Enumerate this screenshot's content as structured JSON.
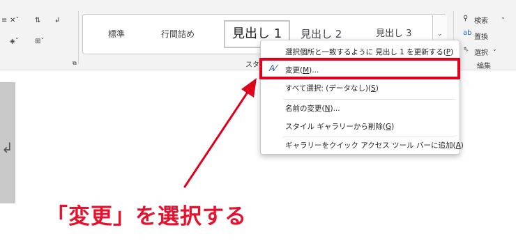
{
  "ribbon": {
    "styles": [
      "標準",
      "行間詰め",
      "見出し 1",
      "見出し 2",
      "見出し 3"
    ],
    "styles_group_label_partial": "スタ",
    "edit": {
      "find": "検索",
      "replace": "置換",
      "select": "選択",
      "group_label": "編集"
    }
  },
  "context_menu": {
    "items": [
      {
        "pre": "選択個所と一致するように 見出し 1 を更新する(",
        "key": "P",
        "post": ")"
      },
      {
        "pre": "変更(",
        "key": "M",
        "post": ")..."
      },
      {
        "pre": "すべて選択: (データなし)(",
        "key": "S",
        "post": ")"
      },
      {
        "pre": "名前の変更(",
        "key": "N",
        "post": ")..."
      },
      {
        "pre": "スタイル ギャラリーから削除(",
        "key": "G",
        "post": ")"
      },
      {
        "pre": "ギャラリーをクイック アクセス ツール バーに追加(",
        "key": "A",
        "post": ")"
      }
    ]
  },
  "annotation": {
    "text": "「変更」を選択する"
  },
  "colors": {
    "highlight": "#e0001b",
    "annotation": "#e8112d"
  }
}
